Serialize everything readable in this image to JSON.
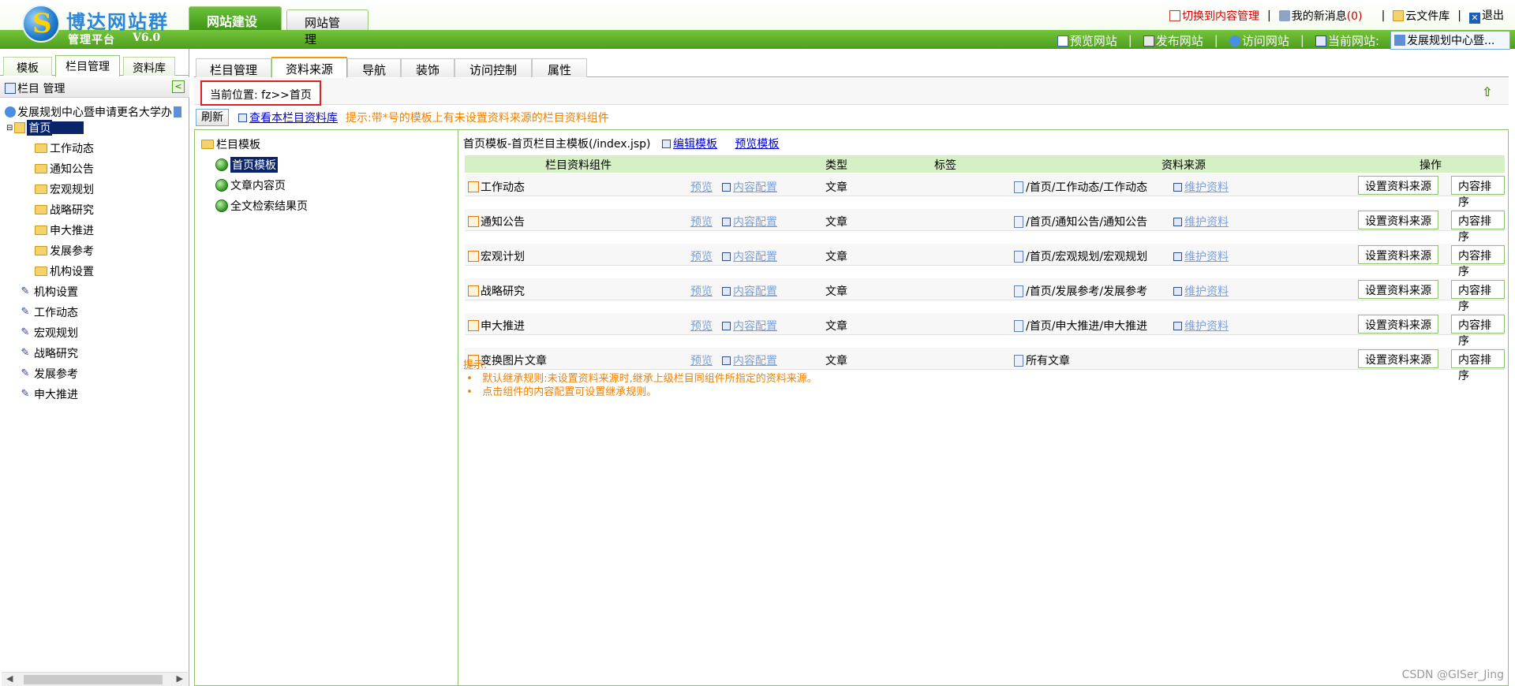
{
  "header": {
    "logo_title": "博达网站群",
    "logo_subtitle": "管理平台",
    "logo_version": "V6.0",
    "main_tabs": [
      {
        "label": "网站建设",
        "active": true
      },
      {
        "label": "网站管理",
        "active": false
      }
    ],
    "top_links": {
      "switch_content": "切换到内容管理",
      "messages": "我的新消息",
      "message_count": "(0)",
      "cloud_files": "云文件库",
      "logout": "退出"
    },
    "bar_links": {
      "preview_site": "预览网站",
      "publish_site": "发布网站",
      "visit_site": "访问网站",
      "current_site_label": "当前网站:",
      "current_site_value": "发展规划中心暨..."
    }
  },
  "left": {
    "tabs": [
      {
        "label": "模板",
        "active": false
      },
      {
        "label": "栏目管理",
        "active": true
      },
      {
        "label": "资料库",
        "active": false
      }
    ],
    "panel_title": "栏目 管理",
    "tree": [
      {
        "label": "发展规划中心暨申请更名大学办",
        "type": "root"
      },
      {
        "label": "首页",
        "type": "home",
        "selected": true
      },
      {
        "label": "工作动态",
        "type": "folder"
      },
      {
        "label": "通知公告",
        "type": "folder"
      },
      {
        "label": "宏观规划",
        "type": "folder"
      },
      {
        "label": "战略研究",
        "type": "folder"
      },
      {
        "label": "申大推进",
        "type": "folder"
      },
      {
        "label": "发展参考",
        "type": "folder"
      },
      {
        "label": "机构设置",
        "type": "folder"
      },
      {
        "label": "机构设置",
        "type": "pen"
      },
      {
        "label": "工作动态",
        "type": "pen"
      },
      {
        "label": "宏观规划",
        "type": "pen"
      },
      {
        "label": "战略研究",
        "type": "pen"
      },
      {
        "label": "发展参考",
        "type": "pen"
      },
      {
        "label": "申大推进",
        "type": "pen"
      }
    ]
  },
  "right": {
    "sub_tabs": [
      {
        "label": "栏目管理",
        "active": false
      },
      {
        "label": "资料来源",
        "active": true
      },
      {
        "label": "导航",
        "active": false
      },
      {
        "label": "装饰",
        "active": false
      },
      {
        "label": "访问控制",
        "active": false
      },
      {
        "label": "属性",
        "active": false
      }
    ],
    "location": "当前位置: fz>>首页",
    "refresh_label": "刷新",
    "view_library_link": "查看本栏目资料库",
    "hint": "提示:带*号的模板上有未设置资料来源的栏目资料组件",
    "template_tree": {
      "root": "栏目模板",
      "items": [
        {
          "label": "首页模板",
          "selected": true
        },
        {
          "label": "文章内容页",
          "selected": false
        },
        {
          "label": "全文检索结果页",
          "selected": false
        }
      ]
    },
    "detail": {
      "title": "首页模板-首页栏目主模板(/index.jsp)",
      "edit_template": "编辑模板",
      "preview_template": "预览模板",
      "columns": [
        "栏目资料组件",
        "类型",
        "标签",
        "资料来源",
        "操作"
      ],
      "rows": [
        {
          "name": "工作动态",
          "preview": "预览",
          "config": "内容配置",
          "type": "文章",
          "tag": "",
          "source": "/首页/工作动态/工作动态",
          "maintain": "维护资料"
        },
        {
          "name": "通知公告",
          "preview": "预览",
          "config": "内容配置",
          "type": "文章",
          "tag": "",
          "source": "/首页/通知公告/通知公告",
          "maintain": "维护资料"
        },
        {
          "name": "宏观计划",
          "preview": "预览",
          "config": "内容配置",
          "type": "文章",
          "tag": "",
          "source": "/首页/宏观规划/宏观规划",
          "maintain": "维护资料"
        },
        {
          "name": "战略研究",
          "preview": "预览",
          "config": "内容配置",
          "type": "文章",
          "tag": "",
          "source": "/首页/发展参考/发展参考",
          "maintain": "维护资料"
        },
        {
          "name": "申大推进",
          "preview": "预览",
          "config": "内容配置",
          "type": "文章",
          "tag": "",
          "source": "/首页/申大推进/申大推进",
          "maintain": "维护资料"
        },
        {
          "name": "变换图片文章",
          "preview": "预览",
          "config": "内容配置",
          "type": "文章",
          "tag": "",
          "source": "所有文章",
          "maintain": ""
        }
      ],
      "btn_set_source": "设置资料来源",
      "btn_sort": "内容排序",
      "tips_title": "提示:",
      "tips": [
        "默认继承规则:未设置资料来源时,继承上级栏目同组件所指定的资料来源。",
        "点击组件的内容配置可设置继承规则。"
      ]
    }
  },
  "watermark": "CSDN @GISer_Jing",
  "colors": {
    "brand_green": "#4f9d1e",
    "hint_orange": "#f08000",
    "alert_red": "#d40000",
    "selection_navy": "#0a246a"
  }
}
